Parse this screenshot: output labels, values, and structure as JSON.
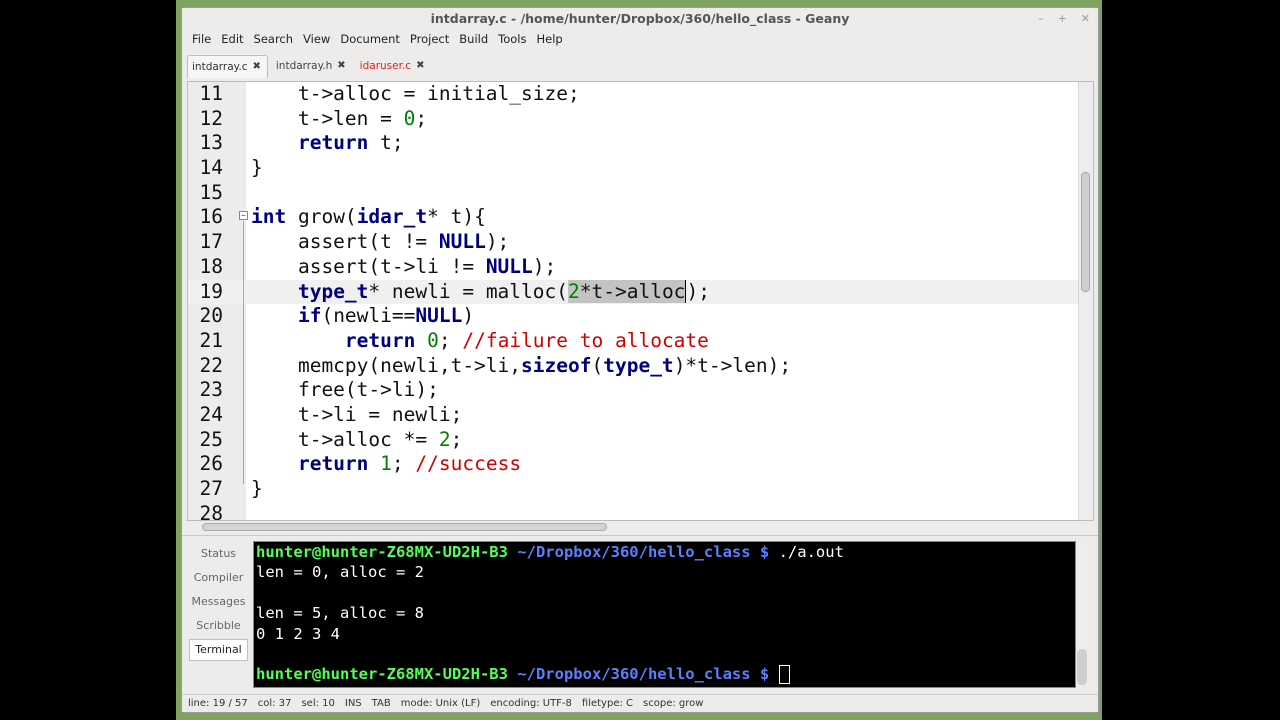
{
  "window": {
    "title": "intdarray.c - /home/hunter/Dropbox/360/hello_class - Geany",
    "minimize": "–",
    "maximize": "+",
    "close": "✕"
  },
  "menu": [
    "File",
    "Edit",
    "Search",
    "View",
    "Document",
    "Project",
    "Build",
    "Tools",
    "Help"
  ],
  "tabs": [
    {
      "label": "intdarray.c",
      "close": "✖"
    },
    {
      "label": "intdarray.h",
      "close": "✖"
    },
    {
      "label": "idaruser.c",
      "close": "✖"
    }
  ],
  "editor": {
    "lines": [
      {
        "n": "11",
        "segments": [
          {
            "c": "",
            "t": "    t->alloc = initial_size;"
          }
        ]
      },
      {
        "n": "12",
        "segments": [
          {
            "c": "",
            "t": "    t->len = "
          },
          {
            "c": "num",
            "t": "0"
          },
          {
            "c": "",
            "t": ";"
          }
        ]
      },
      {
        "n": "13",
        "segments": [
          {
            "c": "",
            "t": "    "
          },
          {
            "c": "kw",
            "t": "return"
          },
          {
            "c": "",
            "t": " t;"
          }
        ]
      },
      {
        "n": "14",
        "segments": [
          {
            "c": "",
            "t": "}"
          }
        ]
      },
      {
        "n": "15",
        "segments": [
          {
            "c": "",
            "t": ""
          }
        ]
      },
      {
        "n": "16",
        "segments": [
          {
            "c": "kw",
            "t": "int"
          },
          {
            "c": "",
            "t": " grow("
          },
          {
            "c": "ty",
            "t": "idar_t"
          },
          {
            "c": "",
            "t": "* t){"
          }
        ]
      },
      {
        "n": "17",
        "segments": [
          {
            "c": "",
            "t": "    assert(t != "
          },
          {
            "c": "kw",
            "t": "NULL"
          },
          {
            "c": "",
            "t": ");"
          }
        ]
      },
      {
        "n": "18",
        "segments": [
          {
            "c": "",
            "t": "    assert(t->li != "
          },
          {
            "c": "kw",
            "t": "NULL"
          },
          {
            "c": "",
            "t": ");"
          }
        ]
      },
      {
        "n": "19",
        "segments": [
          {
            "c": "",
            "t": "    "
          },
          {
            "c": "ty",
            "t": "type_t"
          },
          {
            "c": "",
            "t": "* newli = malloc("
          },
          {
            "c": "num sel",
            "t": "2"
          },
          {
            "c": "sel",
            "t": "*t->alloc"
          },
          {
            "c": "caret",
            "t": ")"
          },
          {
            "c": "",
            "t": ";"
          }
        ]
      },
      {
        "n": "20",
        "segments": [
          {
            "c": "",
            "t": "    "
          },
          {
            "c": "kw",
            "t": "if"
          },
          {
            "c": "",
            "t": "(newli=="
          },
          {
            "c": "kw",
            "t": "NULL"
          },
          {
            "c": "",
            "t": ")"
          }
        ]
      },
      {
        "n": "21",
        "segments": [
          {
            "c": "",
            "t": "        "
          },
          {
            "c": "kw",
            "t": "return"
          },
          {
            "c": "",
            "t": " "
          },
          {
            "c": "num",
            "t": "0"
          },
          {
            "c": "",
            "t": "; "
          },
          {
            "c": "cm",
            "t": "//failure to allocate"
          }
        ]
      },
      {
        "n": "22",
        "segments": [
          {
            "c": "",
            "t": "    memcpy(newli,t->li,"
          },
          {
            "c": "kw",
            "t": "sizeof"
          },
          {
            "c": "",
            "t": "("
          },
          {
            "c": "ty",
            "t": "type_t"
          },
          {
            "c": "",
            "t": ")*t->len);"
          }
        ]
      },
      {
        "n": "23",
        "segments": [
          {
            "c": "",
            "t": "    free(t->li);"
          }
        ]
      },
      {
        "n": "24",
        "segments": [
          {
            "c": "",
            "t": "    t->li = newli;"
          }
        ]
      },
      {
        "n": "25",
        "segments": [
          {
            "c": "",
            "t": "    t->alloc *= "
          },
          {
            "c": "num",
            "t": "2"
          },
          {
            "c": "",
            "t": ";"
          }
        ]
      },
      {
        "n": "26",
        "segments": [
          {
            "c": "",
            "t": "    "
          },
          {
            "c": "kw",
            "t": "return"
          },
          {
            "c": "",
            "t": " "
          },
          {
            "c": "num",
            "t": "1"
          },
          {
            "c": "",
            "t": "; "
          },
          {
            "c": "cm",
            "t": "//success"
          }
        ]
      },
      {
        "n": "27",
        "segments": [
          {
            "c": "",
            "t": "}"
          }
        ]
      },
      {
        "n": "28",
        "segments": [
          {
            "c": "",
            "t": ""
          }
        ]
      }
    ]
  },
  "message_tabs": [
    "Status",
    "Compiler",
    "Messages",
    "Scribble",
    "Terminal"
  ],
  "terminal": {
    "prompt_user": "hunter@hunter-Z68MX-UD2H-B3",
    "prompt_path": " ~/Dropbox/360/hello_class $",
    "command": " ./a.out",
    "output": [
      "len = 0, alloc = 2",
      "",
      "len = 5, alloc = 8",
      "0 1 2 3 4",
      ""
    ]
  },
  "statusbar": [
    "line: 19 / 57",
    "col: 37",
    "sel: 10",
    "INS",
    "TAB",
    "mode: Unix (LF)",
    "encoding: UTF-8",
    "filetype: C",
    "scope: grow"
  ]
}
